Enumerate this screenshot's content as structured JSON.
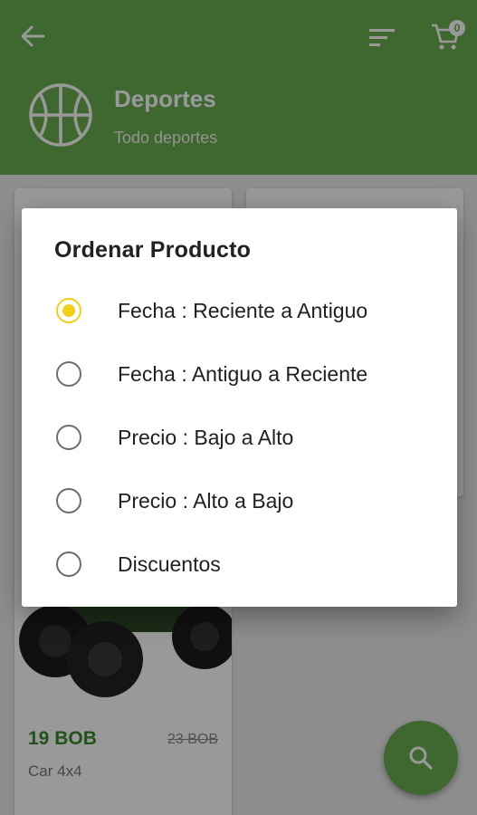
{
  "header": {
    "category_title": "Deportes",
    "category_subtitle": "Todo deportes",
    "cart_count": "0",
    "color": "#6aad50"
  },
  "product": {
    "price": "19 BOB",
    "old_price": "23 BOB",
    "name": "Car 4x4"
  },
  "dialog": {
    "title": "Ordenar Producto",
    "options": [
      {
        "label": "Fecha : Reciente a Antiguo",
        "selected": true
      },
      {
        "label": "Fecha : Antiguo a Reciente",
        "selected": false
      },
      {
        "label": "Precio : Bajo a Alto",
        "selected": false
      },
      {
        "label": "Precio : Alto a Bajo",
        "selected": false
      },
      {
        "label": "Discuentos",
        "selected": false
      }
    ],
    "accent": "#f3d017"
  },
  "icons": {
    "back": "arrow-back-icon",
    "sort": "sort-icon",
    "cart": "cart-icon",
    "category": "basketball-icon",
    "search": "search-icon"
  }
}
